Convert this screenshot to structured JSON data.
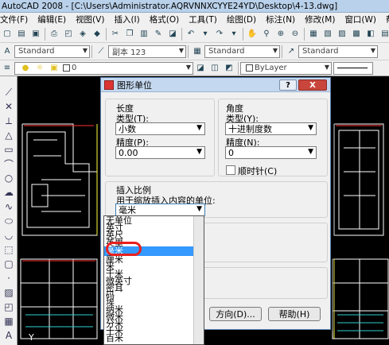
{
  "window": {
    "title": "AutoCAD 2008 - [C:\\Users\\Administrator.AQRVNNXCYYE24YD\\Desktop\\4-13.dwg]"
  },
  "menu": [
    "文件(F)",
    "编辑(E)",
    "视图(V)",
    "插入(I)",
    "格式(O)",
    "工具(T)",
    "绘图(D)",
    "标注(N)",
    "修改(M)",
    "窗口(W)",
    "帮助(H)"
  ],
  "toolbar2": {
    "textstyle": "Standard",
    "dimstyle": "副本 123",
    "tablestyle": "Standard",
    "mleaderstyle": "Standard"
  },
  "toolbar3": {
    "layer_value": "0",
    "color_value": "ByLayer"
  },
  "dialog": {
    "title": "图形单位",
    "help_glyph": "?",
    "close_glyph": "X",
    "length": {
      "group": "长度",
      "type_label": "类型(T):",
      "type_value": "小数",
      "precision_label": "精度(P):",
      "precision_value": "0.00"
    },
    "angle": {
      "group": "角度",
      "type_label": "类型(Y):",
      "type_value": "十进制度数",
      "precision_label": "精度(N):",
      "precision_value": "0",
      "clockwise_label": "顺时针(C)",
      "clockwise_checked": false
    },
    "insert": {
      "group": "插入比例",
      "desc": "用于缩放插入内容的单位:",
      "value": "毫米"
    },
    "buttons": {
      "direction": "方向(D)...",
      "help": "帮助(H)"
    },
    "unit_options": [
      "无单位",
      "英寸",
      "英尺",
      "英里",
      "毫米",
      "厘米",
      "米",
      "千米",
      "微英寸",
      "密耳",
      "码",
      "埃",
      "纳米",
      "微米",
      "分米",
      "十米",
      "百米"
    ],
    "selected_option": "毫米"
  },
  "canvas": {
    "axis_label": "Y"
  }
}
